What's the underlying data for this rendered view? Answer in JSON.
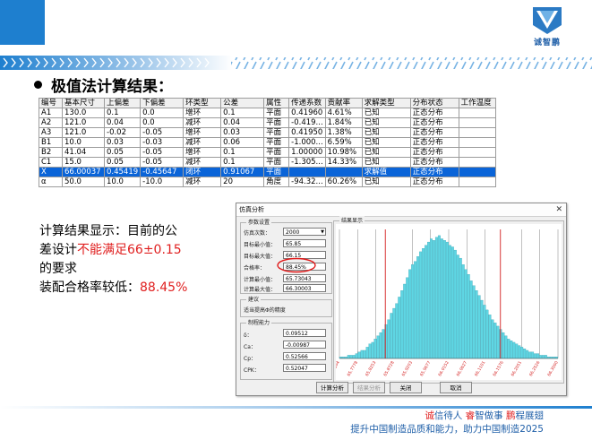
{
  "logo": {
    "text": "诚智鹏"
  },
  "heading": "极值法计算结果：",
  "table": {
    "headers": [
      "编号",
      "基本尺寸",
      "上偏差",
      "下偏差",
      "环类型",
      "公差",
      "属性",
      "传递系数",
      "贡献率",
      "求解类型",
      "分布状态",
      "工作温度"
    ],
    "rows": [
      [
        "A1",
        "130.0",
        "0.1",
        "0.0",
        "增环",
        "0.1",
        "平面",
        "0.41960",
        "4.61%",
        "已知",
        "正态分布",
        ""
      ],
      [
        "A2",
        "121.0",
        "0.04",
        "0.0",
        "减环",
        "0.04",
        "平面",
        "-0.419...",
        "1.84%",
        "已知",
        "正态分布",
        ""
      ],
      [
        "A3",
        "121.0",
        "-0.02",
        "-0.05",
        "增环",
        "0.03",
        "平面",
        "0.41950",
        "1.38%",
        "已知",
        "正态分布",
        ""
      ],
      [
        "B1",
        "10.0",
        "0.03",
        "-0.03",
        "减环",
        "0.06",
        "平面",
        "-1.000...",
        "6.59%",
        "已知",
        "正态分布",
        ""
      ],
      [
        "B2",
        "41.04",
        "0.05",
        "-0.05",
        "增环",
        "0.1",
        "平面",
        "1.00000",
        "10.98%",
        "已知",
        "正态分布",
        ""
      ],
      [
        "C1",
        "15.0",
        "0.05",
        "-0.05",
        "减环",
        "0.1",
        "平面",
        "-1.305...",
        "14.33%",
        "已知",
        "正态分布",
        ""
      ],
      [
        "X",
        "66.00037",
        "0.45419",
        "-0.45647",
        "闭环",
        "0.91067",
        "平面",
        "",
        "",
        "求解值",
        "正态分布",
        ""
      ],
      [
        "α",
        "50.0",
        "10.0",
        "-10.0",
        "减环",
        "20",
        "角度",
        "-94.32...",
        "60.26%",
        "已知",
        "正态分布",
        ""
      ]
    ]
  },
  "explain": {
    "line1": "计算结果显示：目前的公",
    "line2a": "差设计",
    "line2b": "不能满足66±0.15",
    "line3": "的要求",
    "line4a": "装配合格率较低：",
    "line4b": "88.45%"
  },
  "dialog": {
    "title": "仿真分析",
    "close": "✕",
    "params_group": "参数设置",
    "sim_count_label": "仿真次数：",
    "sim_count_value": "2000",
    "target_min_label": "目标最小值：",
    "target_min_value": "65.85",
    "target_max_label": "目标最大值：",
    "target_max_value": "66.15",
    "pass_rate_label": "合格率：",
    "pass_rate_value": "88.45%",
    "calc_min_label": "计算最小值：",
    "calc_min_value": "65.73043",
    "calc_max_label": "计算最大值：",
    "calc_max_value": "66.30003",
    "advice_group": "建议",
    "advice_text": "适当提高Φ的精度",
    "capability_group": "制程能力",
    "delta_label": "δ：",
    "delta_value": "0.09512",
    "ca_label": "Ca：",
    "ca_value": "-0.00987",
    "cp_label": "Cp：",
    "cp_value": "0.52566",
    "cpk_label": "CPK：",
    "cpk_value": "0.52047",
    "result_group": "结果显示",
    "btn_simulate": "计算分析",
    "btn_result": "结果分析",
    "btn_close": "关闭",
    "btn_cancel": "取消"
  },
  "chart_data": {
    "type": "bar",
    "title": "",
    "xlabel": "",
    "ylabel": "",
    "x_ticks": [
      "65.7304",
      "65.7778",
      "65.8253",
      "65.8728",
      "65.9203",
      "65.9677",
      "66.0152",
      "66.0627",
      "66.1101",
      "66.1576",
      "66.2051",
      "66.2526",
      "66.3000"
    ],
    "bin_start": 65.7304,
    "bin_end": 66.3,
    "values": [
      1,
      1,
      1,
      2,
      2,
      2,
      3,
      4,
      5,
      5,
      7,
      9,
      10,
      12,
      14,
      16,
      18,
      21,
      24,
      28,
      31,
      34,
      38,
      42,
      46,
      50,
      55,
      58,
      60,
      63,
      66,
      68,
      70,
      72,
      74,
      73,
      75,
      76,
      74,
      73,
      72,
      70,
      69,
      67,
      64,
      62,
      58,
      55,
      52,
      48,
      45,
      42,
      39,
      36,
      33,
      30,
      27,
      24,
      22,
      20,
      18,
      16,
      14,
      12,
      11,
      10,
      9,
      8,
      7,
      6,
      5,
      4,
      4,
      3,
      3,
      2,
      2,
      2,
      1,
      1,
      1,
      1
    ],
    "limit_lines": [
      65.85,
      66.15
    ],
    "center_lines": [
      65.7304,
      65.7778,
      65.8253,
      65.9203,
      65.9677,
      66.0152,
      66.0627,
      66.1101,
      66.2051,
      66.2526,
      66.3
    ],
    "colors": {
      "bar": "#5fd6e3",
      "bar_edge": "#3a9fb0",
      "limit": "#d42020",
      "grid": "#808080",
      "tick_text": "#d42020"
    }
  },
  "footer": {
    "slogan1_parts": [
      "诚",
      "信待人 ",
      "睿",
      "智做事 ",
      "鹏",
      "程展翅"
    ],
    "slogan2": "提升中国制造品质和能力，助力中国制造2025"
  }
}
